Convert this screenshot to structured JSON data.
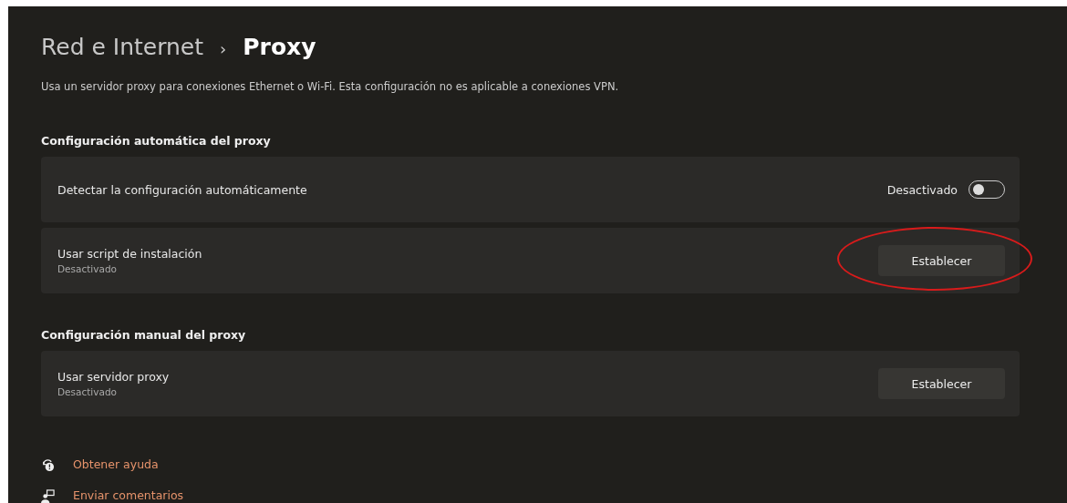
{
  "breadcrumb": {
    "parent": "Red e Internet",
    "separator": "›",
    "current": "Proxy"
  },
  "description": "Usa un servidor proxy para conexiones Ethernet o Wi-Fi. Esta configuración no es aplicable a conexiones VPN.",
  "sections": [
    {
      "title": "Configuración automática del proxy",
      "rows": [
        {
          "kind": "toggle",
          "label": "Detectar la configuración automáticamente",
          "state_text": "Desactivado",
          "on": false
        },
        {
          "kind": "button",
          "label": "Usar script de instalación",
          "subtitle": "Desactivado",
          "button": "Establecer",
          "circled": true
        }
      ]
    },
    {
      "title": "Configuración manual del proxy",
      "rows": [
        {
          "kind": "button",
          "label": "Usar servidor proxy",
          "subtitle": "Desactivado",
          "button": "Establecer",
          "circled": false
        }
      ]
    }
  ],
  "links": [
    {
      "kind": "help",
      "label": "Obtener ayuda"
    },
    {
      "kind": "feedback",
      "label": "Enviar comentarios"
    }
  ]
}
